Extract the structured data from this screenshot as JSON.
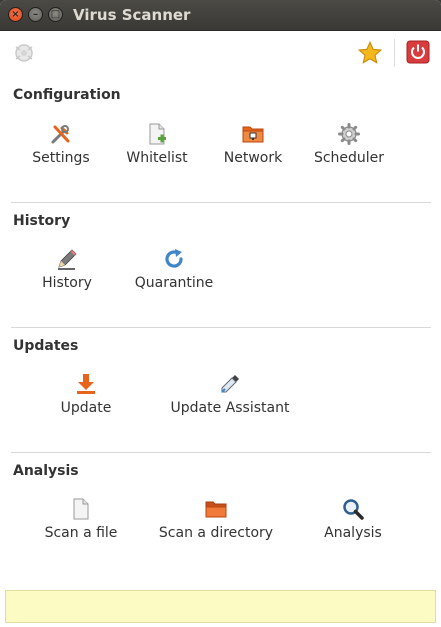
{
  "window": {
    "title": "Virus Scanner",
    "close_symbol": "×",
    "minimize_symbol": "–",
    "maximize_symbol": "□"
  },
  "toolbar": {
    "left_icon": "app-logo-icon",
    "favorite_icon": "star-icon",
    "power_icon": "power-icon"
  },
  "sections": {
    "configuration": {
      "title": "Configuration",
      "items": [
        {
          "label": "Settings",
          "icon": "settings-tools-icon"
        },
        {
          "label": "Whitelist",
          "icon": "document-add-icon"
        },
        {
          "label": "Network",
          "icon": "network-folder-icon"
        },
        {
          "label": "Scheduler",
          "icon": "gear-icon"
        }
      ]
    },
    "history": {
      "title": "History",
      "items": [
        {
          "label": "History",
          "icon": "pencil-icon"
        },
        {
          "label": "Quarantine",
          "icon": "refresh-icon"
        }
      ]
    },
    "updates": {
      "title": "Updates",
      "items": [
        {
          "label": "Update",
          "icon": "download-icon"
        },
        {
          "label": "Update Assistant",
          "icon": "eyedropper-icon"
        }
      ]
    },
    "analysis": {
      "title": "Analysis",
      "items": [
        {
          "label": "Scan a file",
          "icon": "file-icon"
        },
        {
          "label": "Scan a directory",
          "icon": "folder-icon"
        },
        {
          "label": "Analysis",
          "icon": "magnifier-icon"
        }
      ]
    }
  },
  "colors": {
    "accent_orange": "#e8641b",
    "power_red": "#d93c3c",
    "star_yellow": "#f5b81c",
    "status_bg": "#fcfbc4"
  },
  "statusbar": {
    "text": ""
  }
}
